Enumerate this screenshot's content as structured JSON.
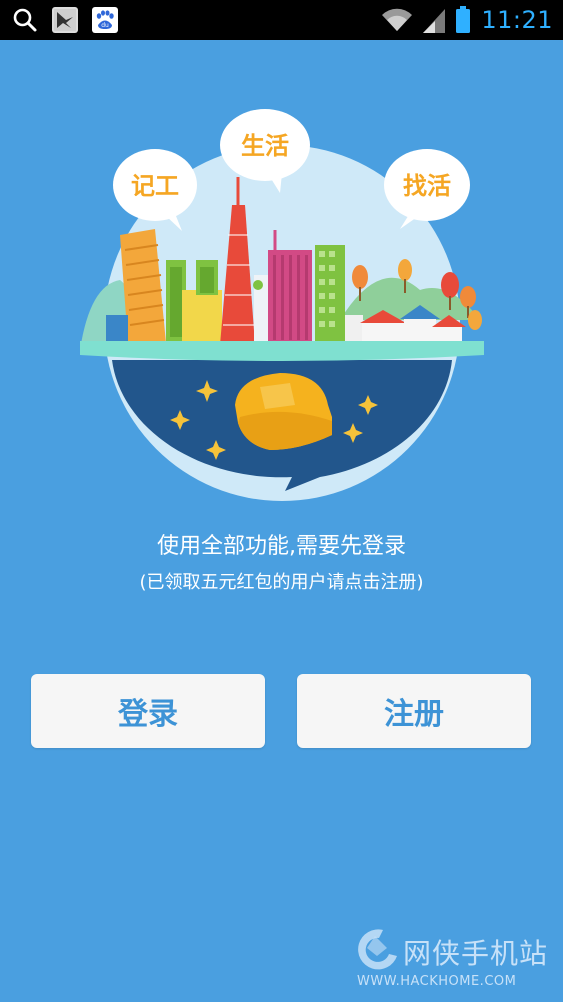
{
  "status_bar": {
    "time": "11:21",
    "left_icons": [
      "search-icon",
      "image-app-icon",
      "baidu-app-icon"
    ],
    "right_icons": [
      "wifi-icon",
      "signal-icon",
      "battery-icon"
    ],
    "baidu_label": "du"
  },
  "illustration": {
    "bubbles": [
      "记工",
      "生活",
      "找活"
    ]
  },
  "messages": {
    "tagline": "使用全部功能,需要先登录",
    "subline": "(已领取五元红包的用户请点击注册)"
  },
  "buttons": {
    "login": "登录",
    "register": "注册"
  },
  "watermark": {
    "name": "网侠手机站",
    "url": "WWW.HACKHOME.COM"
  },
  "colors": {
    "background": "#4a9fe0",
    "button_text": "#3d93d6",
    "clock": "#2fb0ff",
    "bubble_text": "#f5a623"
  }
}
